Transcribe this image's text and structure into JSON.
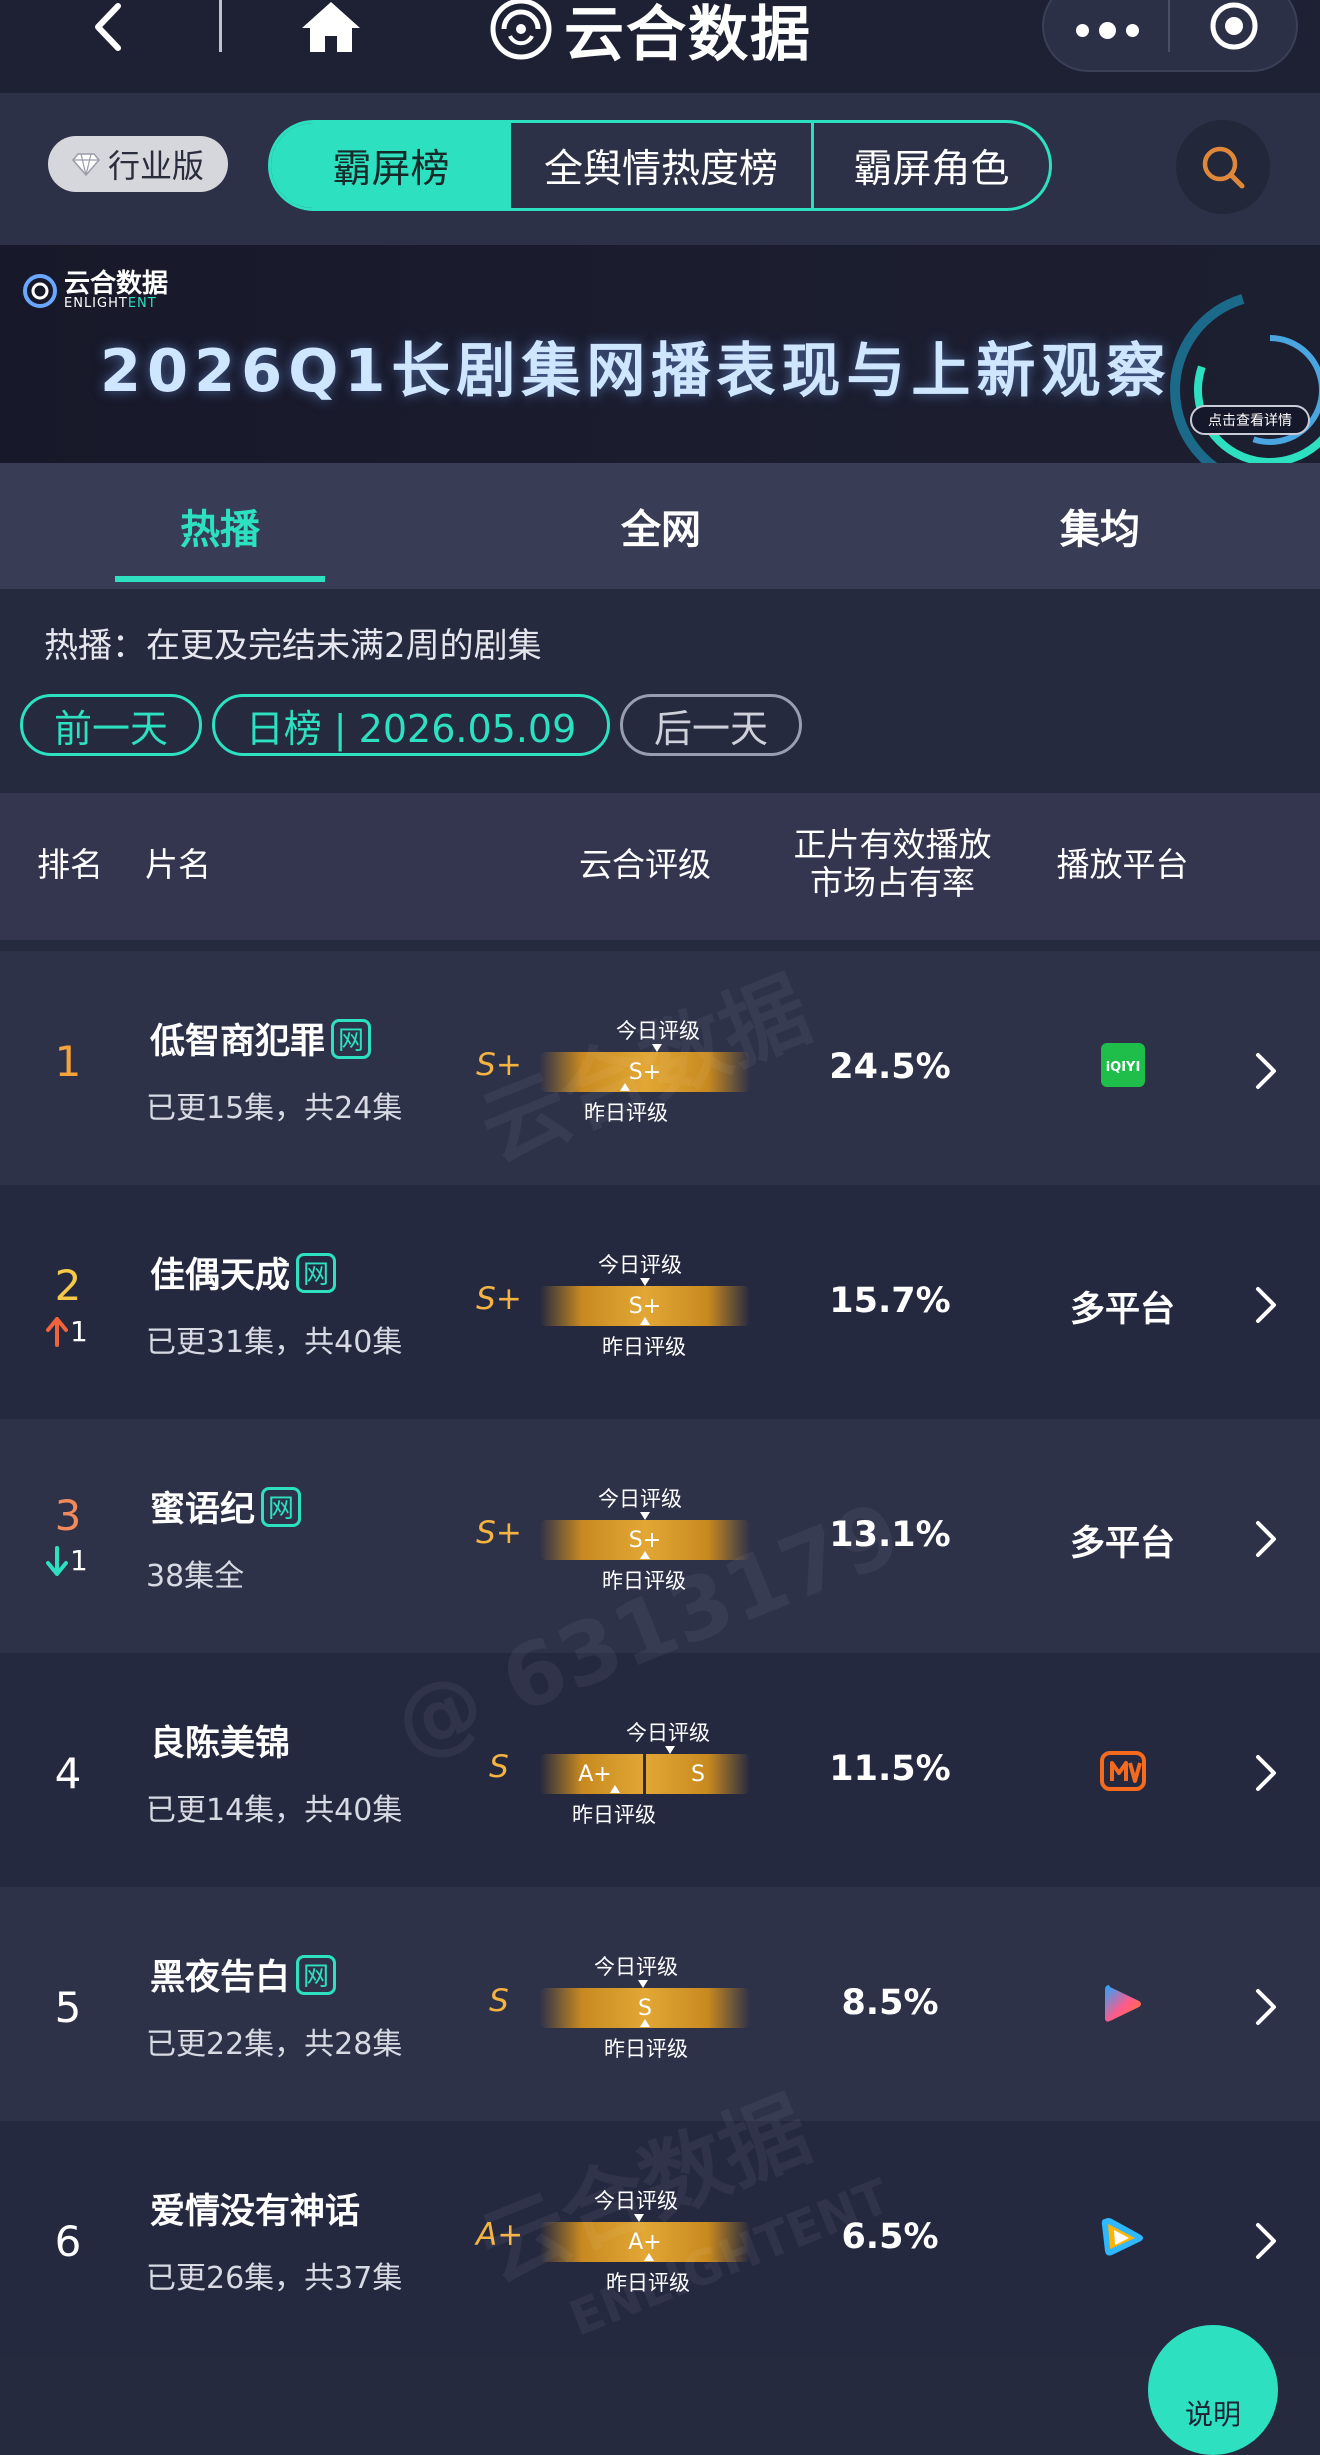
{
  "app": {
    "title": "云合数据"
  },
  "nav": {
    "industry_badge": "行业版",
    "segments": [
      "霸屏榜",
      "全舆情热度榜",
      "霸屏角色"
    ]
  },
  "banner": {
    "logo_cn": "云合数据",
    "logo_en_a": "ENLIGHT",
    "logo_en_b": "ENT",
    "title": "2026Q1长剧集网播表现与上新观察",
    "button": "点击查看详情"
  },
  "tabs": [
    "热播",
    "全网",
    "集均"
  ],
  "description": "热播：在更及完结未满2周的剧集",
  "date_nav": {
    "prev": "前一天",
    "current": "日榜 | 2026.05.09",
    "next": "后一天"
  },
  "table": {
    "headers": {
      "rank": "排名",
      "title": "片名",
      "rating": "云合评级",
      "share_line1": "正片有效播放",
      "share_line2": "市场占有率",
      "platform": "播放平台"
    },
    "today_label": "今日评级",
    "yesterday_label": "昨日评级",
    "net_tag": "网",
    "rows": [
      {
        "rank": "1",
        "change": "",
        "title": "低智商犯罪",
        "net": true,
        "episodes": "已更15集，共24集",
        "grade": "S+",
        "yesterday": "S+",
        "today": "S+",
        "share": "24.5%",
        "platform_text": "",
        "platform_icon": "iqiyi-icon",
        "rank_color": "#f5a33b"
      },
      {
        "rank": "2",
        "change": "1",
        "change_dir": "up",
        "title": "佳偶天成",
        "net": true,
        "episodes": "已更31集，共40集",
        "grade": "S+",
        "yesterday": "S+",
        "today": "S+",
        "share": "15.7%",
        "platform_text": "多平台",
        "platform_icon": "",
        "rank_color": "#f7c948"
      },
      {
        "rank": "3",
        "change": "1",
        "change_dir": "down",
        "title": "蜜语纪",
        "net": true,
        "episodes": "38集全",
        "grade": "S+",
        "yesterday": "S+",
        "today": "S+",
        "share": "13.1%",
        "platform_text": "多平台",
        "platform_icon": "",
        "rank_color": "#f08a5d"
      },
      {
        "rank": "4",
        "change": "",
        "title": "良陈美锦",
        "net": false,
        "episodes": "已更14集，共40集",
        "grade": "S",
        "yesterday": "A+",
        "today": "S",
        "share": "11.5%",
        "platform_text": "",
        "platform_icon": "mango-tv-icon",
        "rank_color": "#ffffff"
      },
      {
        "rank": "5",
        "change": "",
        "title": "黑夜告白",
        "net": true,
        "episodes": "已更22集，共28集",
        "grade": "S",
        "yesterday": "S",
        "today": "S",
        "share": "8.5%",
        "platform_text": "",
        "platform_icon": "youku-icon",
        "rank_color": "#ffffff"
      },
      {
        "rank": "6",
        "change": "",
        "title": "爱情没有神话",
        "net": false,
        "episodes": "已更26集，共37集",
        "grade": "A+",
        "yesterday": "A+",
        "today": "A+",
        "share": "6.5%",
        "platform_text": "",
        "platform_icon": "tencent-video-icon",
        "rank_color": "#ffffff"
      }
    ]
  },
  "watermark": {
    "brand": "云合数据",
    "brand_en": "ENLIGHTENT",
    "id": "@ 6313179"
  },
  "help_button": "说明",
  "colors": {
    "accent": "#2ce0c0",
    "grade": "#f5b341",
    "up": "#f0643c",
    "down": "#2ce0c0"
  }
}
